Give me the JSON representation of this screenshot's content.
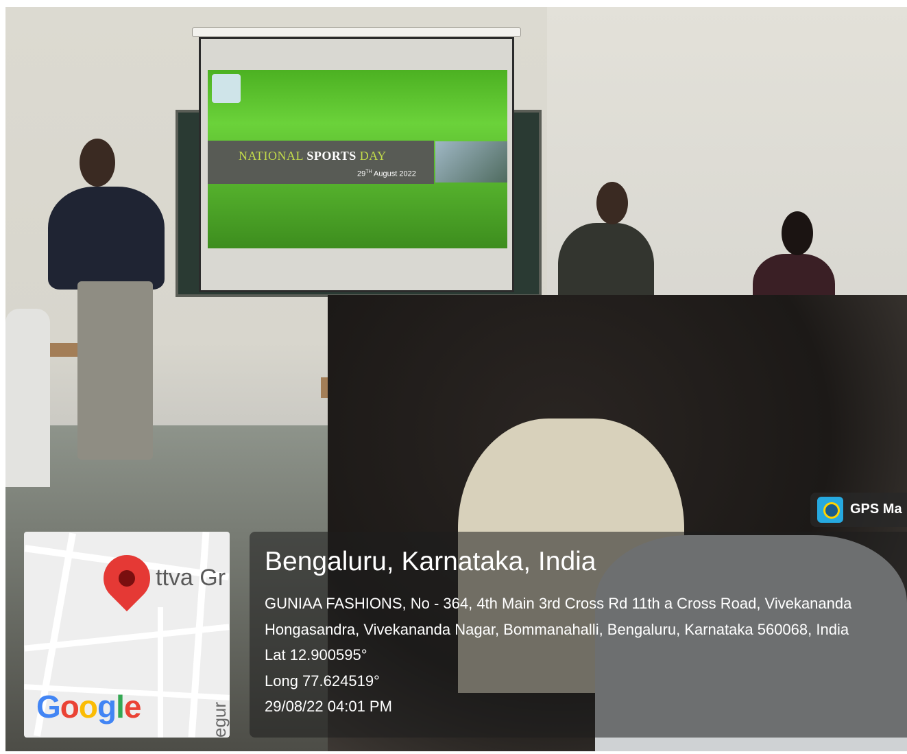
{
  "slide": {
    "title_part1": "NATIONAL ",
    "title_part2": "SPORTS",
    "title_part3": " DAY",
    "date_day": "29",
    "date_suffix": "TH",
    "date_rest": " August 2022"
  },
  "map": {
    "place_label": "ttva Gr",
    "road_label": "egur Rd",
    "logo_text": "Google"
  },
  "gps_badge": {
    "label": "GPS Ma",
    "icon": "gps-camera-icon"
  },
  "location": {
    "title": "Bengaluru, Karnataka, India",
    "address_line1": "GUNIAA FASHIONS, No - 364, 4th Main 3rd Cross Rd 11th a Cross Road, Vivekananda",
    "address_line2": "Hongasandra, Vivekananda Nagar, Bommanahalli, Bengaluru, Karnataka 560068, India",
    "lat": "Lat 12.900595°",
    "long": "Long 77.624519°",
    "datetime": "29/08/22 04:01 PM"
  }
}
